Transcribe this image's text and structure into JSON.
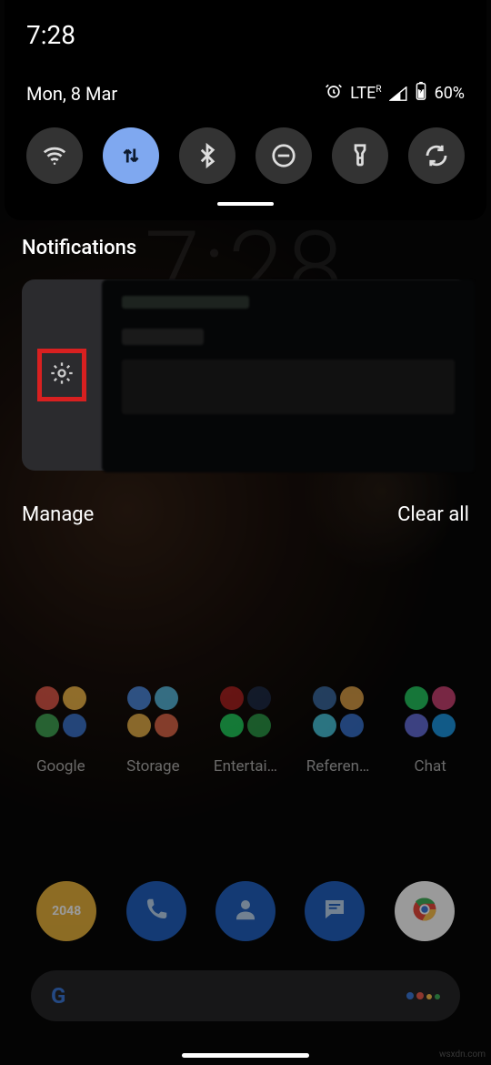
{
  "status": {
    "time": "7:28",
    "date": "Mon, 8 Mar",
    "alarm_icon": "alarm",
    "network_label": "LTE",
    "network_sup": "R",
    "battery_pct": "60%"
  },
  "bg_clock": "7:28",
  "quick_settings": [
    {
      "name": "wifi-toggle",
      "icon": "wifi",
      "active": false
    },
    {
      "name": "mobile-data-toggle",
      "icon": "data",
      "active": true
    },
    {
      "name": "bluetooth-toggle",
      "icon": "bluetooth",
      "active": false
    },
    {
      "name": "dnd-toggle",
      "icon": "dnd",
      "active": false
    },
    {
      "name": "flashlight-toggle",
      "icon": "flashlight",
      "active": false
    },
    {
      "name": "autorotate-toggle",
      "icon": "rotate",
      "active": false
    }
  ],
  "notifications": {
    "header": "Notifications",
    "manage_label": "Manage",
    "clear_label": "Clear all",
    "gear_highlighted": true
  },
  "folders": [
    {
      "label": "Google",
      "colors": [
        "#e85a4a",
        "#fbc04a",
        "#3fae58",
        "#3a78d8"
      ]
    },
    {
      "label": "Storage",
      "colors": [
        "#4a8de8",
        "#56c1e8",
        "#f0b84a",
        "#e86a4a"
      ]
    },
    {
      "label": "Entertai…",
      "colors": [
        "#b02020",
        "#1a2a48",
        "#1ed760",
        "#2aa04a"
      ]
    },
    {
      "label": "Referen…",
      "colors": [
        "#3a6ea8",
        "#e8a84a",
        "#4acfe8",
        "#3a78d8"
      ]
    },
    {
      "label": "Chat",
      "colors": [
        "#25d366",
        "#d8447a",
        "#6a74e8",
        "#1da1f2"
      ]
    }
  ],
  "dock": [
    {
      "name": "app-2048",
      "bg": "#e8b23a",
      "label": "2048"
    },
    {
      "name": "app-phone",
      "bg": "#1f5fbf",
      "icon": "phone"
    },
    {
      "name": "app-contacts",
      "bg": "#1f5fbf",
      "icon": "person"
    },
    {
      "name": "app-messages",
      "bg": "#1f5fbf",
      "icon": "message"
    },
    {
      "name": "app-chrome",
      "bg": "#ffffff",
      "icon": "chrome"
    }
  ],
  "search": {
    "logo": "G",
    "assistant": "assistant-icon"
  },
  "watermark": "wsxdn.com"
}
